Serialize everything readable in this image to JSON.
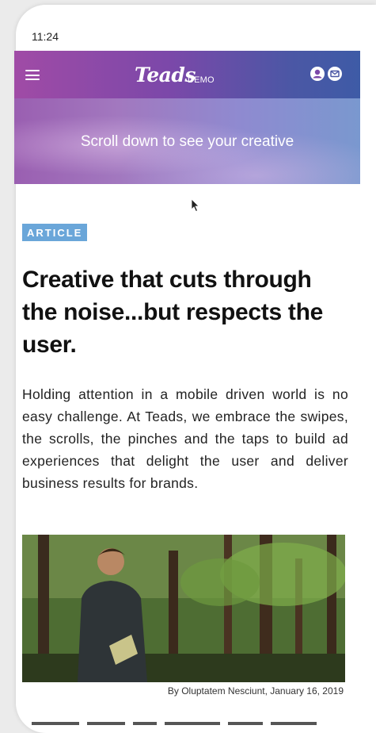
{
  "status_bar": {
    "time": "11:24"
  },
  "header": {
    "logo": "Teads",
    "logo_suffix": "DEMO",
    "icons": [
      "menu-icon",
      "user-icon",
      "mail-icon"
    ],
    "gradient": [
      "#a04ba6",
      "#3e5ba6"
    ]
  },
  "banner": {
    "text": "Scroll down to see your creative"
  },
  "article": {
    "badge": "ARTICLE",
    "badge_color": "#6aa6d9",
    "headline": "Creative that cuts through the noise...but respects the user.",
    "body": "Holding attention in a mobile driven world is no easy challenge. At Teads, we embrace the swipes, the scrolls, the pinches and the taps to build ad experiences that delight the user and deliver business results for brands.",
    "image_caption": "By Oluptatem Nesciunt, January 16, 2019"
  }
}
